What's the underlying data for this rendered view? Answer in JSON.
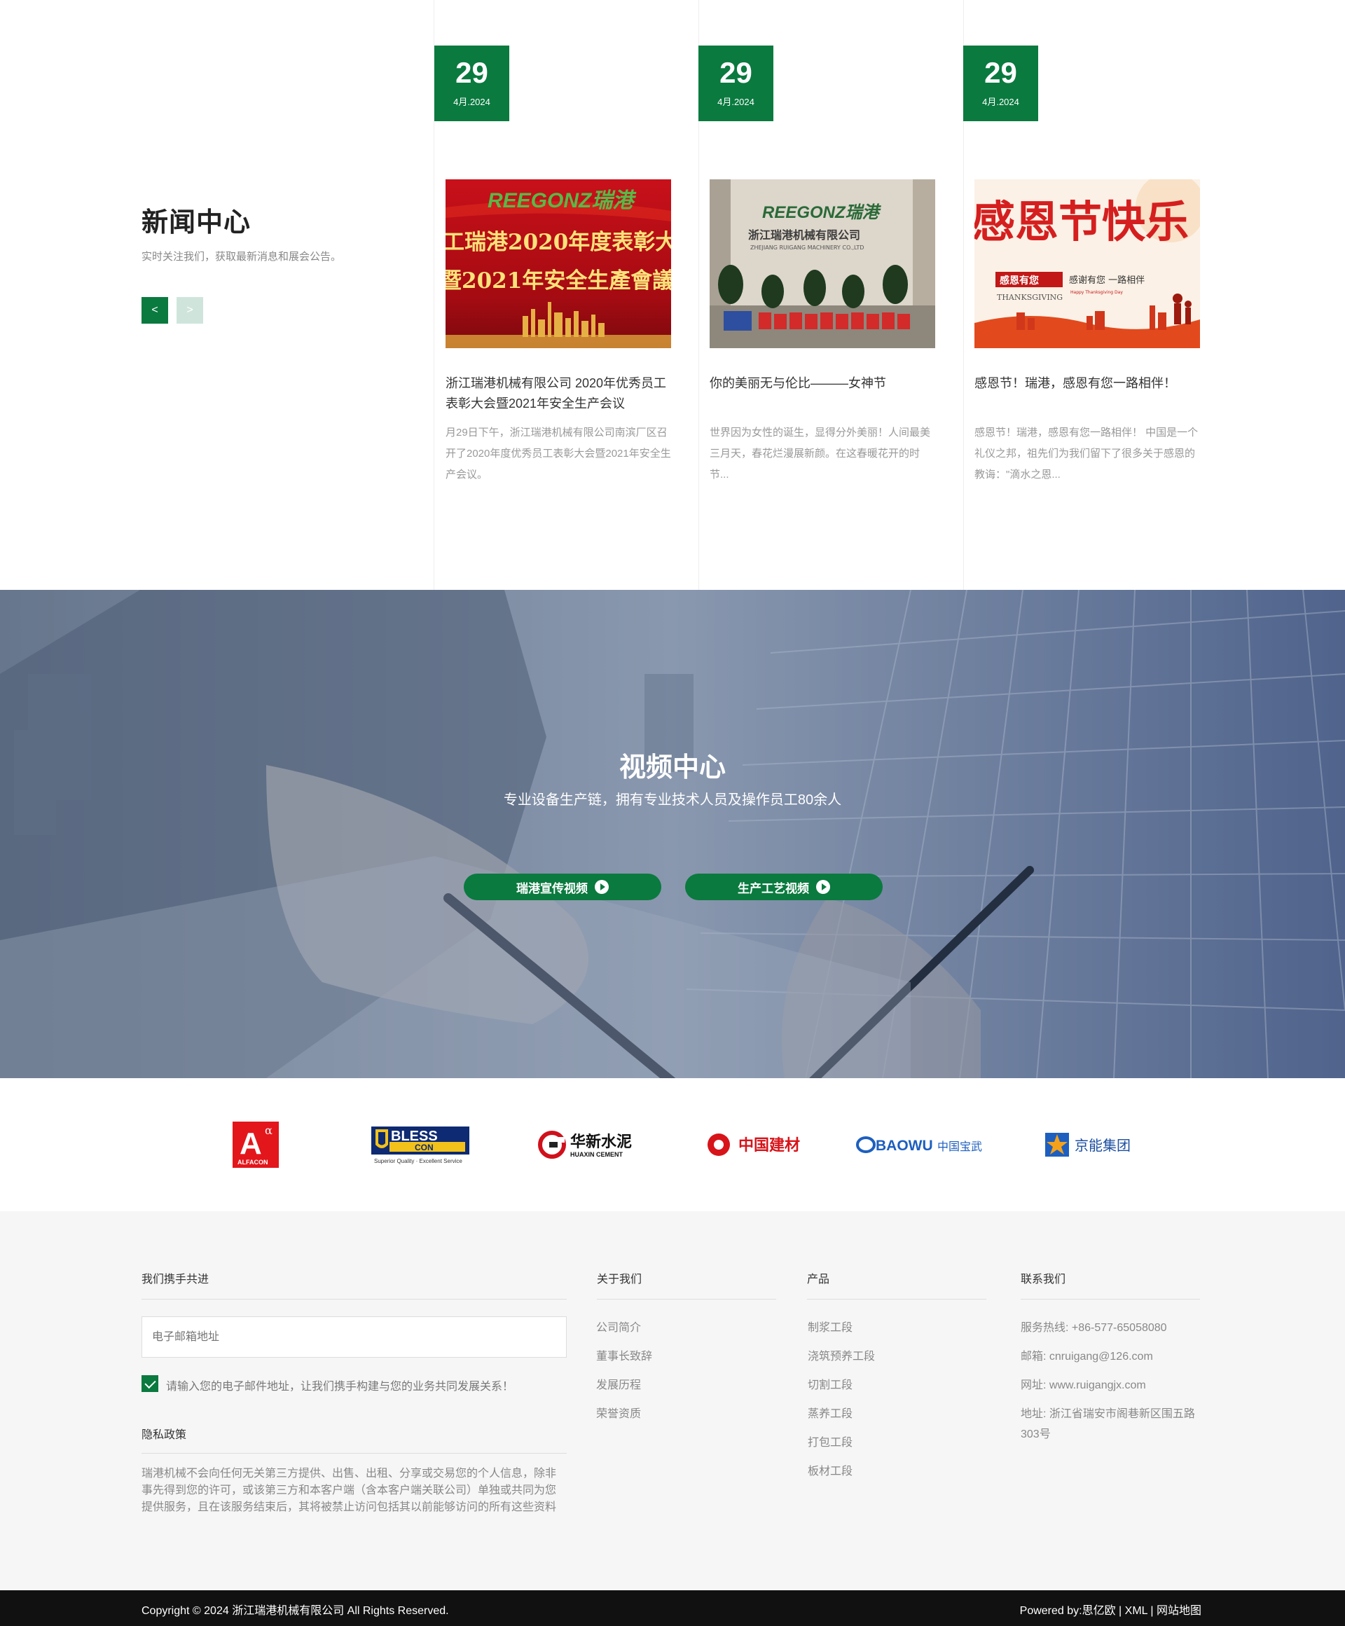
{
  "news": {
    "title": "新闻中心",
    "subtitle": "实时关注我们，获取最新消息和展会公告。",
    "prev_label": "<",
    "next_label": ">",
    "items": [
      {
        "day": "29",
        "month": "4月.2024",
        "title": "浙江瑞港机械有限公司 2020年优秀员工表彰大会暨2021年安全生产会议",
        "desc": "月29日下午，浙江瑞港机械有限公司南滨厂区召开了2020年度优秀员工表彰大会暨2021年安全生产会议。",
        "image_text_1": "REEGONZ瑞港",
        "image_text_2": "工瑞港2020年度表彰大",
        "image_text_3": "暨2021年安全生產會議"
      },
      {
        "day": "29",
        "month": "4月.2024",
        "title": "你的美丽无与伦比———女神节",
        "desc": "世界因为女性的诞生，显得分外美丽！人间最美三月天，春花烂漫展新颜。在这春暖花开的时节...",
        "image_text_1": "REEGONZ瑞港",
        "image_text_2": "浙江瑞港机械有限公司",
        "image_text_3": "ZHEJIANG RUIGANG MACHINERY CO.,LTD"
      },
      {
        "day": "29",
        "month": "4月.2024",
        "title": "感恩节！瑞港，感恩有您一路相伴！",
        "desc": "感恩节！瑞港，感恩有您一路相伴！ 中国是一个礼仪之邦，祖先们为我们留下了很多关于感恩的教诲：\"滴水之恩...",
        "image_text_1": "感恩节快乐",
        "image_text_2": "感恩有您",
        "image_text_3": "感谢有您 一路相伴",
        "image_text_4": "THANKSGIVING",
        "image_text_5": "Happy Thanksgiving Day"
      }
    ]
  },
  "video": {
    "title": "视频中心",
    "subtitle": "专业设备生产链，拥有专业技术人员及操作员工80余人",
    "buttons": [
      "瑞港宣传视频",
      "生产工艺视频"
    ]
  },
  "partners": [
    {
      "name": "ALFACON",
      "mark": "A",
      "sup": "α"
    },
    {
      "name": "BLESS",
      "sub": "CON",
      "tagline": "Superior Quality · Excellent Service"
    },
    {
      "name": "华新水泥",
      "sub": "HUAXIN CEMENT"
    },
    {
      "name": "中国建材"
    },
    {
      "name": "BAOWU",
      "sub": "中国宝武"
    },
    {
      "name": "京能集团"
    }
  ],
  "footer": {
    "subscribe": {
      "heading": "我们携手共进",
      "placeholder": "电子邮箱地址",
      "check_label": "请输入您的电子邮件地址，让我们携手构建与您的业务共同发展关系！"
    },
    "privacy": {
      "heading": "隐私政策",
      "text": "瑞港机械不会向任何无关第三方提供、出售、出租、分享或交易您的个人信息，除非事先得到您的许可，或该第三方和本客户端（含本客户端关联公司）单独或共同为您提供服务，且在该服务结束后，其将被禁止访问包括其以前能够访问的所有这些资料"
    },
    "about": {
      "heading": "关于我们",
      "links": [
        "公司简介",
        "董事长致辞",
        "发展历程",
        "荣誉资质"
      ]
    },
    "products": {
      "heading": "产品",
      "links": [
        "制浆工段",
        "浇筑预养工段",
        "切割工段",
        "蒸养工段",
        "打包工段",
        "板材工段"
      ]
    },
    "contact": {
      "heading": "联系我们",
      "hotline": "服务热线: +86-577-65058080",
      "email": "邮箱: cnruigang@126.com",
      "website": "网址: www.ruigangjx.com",
      "address": "地址: 浙江省瑞安市阁巷新区围五路303号"
    },
    "copyright": "Copyright © 2024 浙江瑞港机械有限公司 All Rights Reserved.",
    "powered": "Powered by:思亿欧 | XML | 网站地图"
  },
  "colors": {
    "brand_green": "#0a7a3f",
    "footer_bg": "#f6f6f6",
    "bottom_bar": "#111111"
  }
}
